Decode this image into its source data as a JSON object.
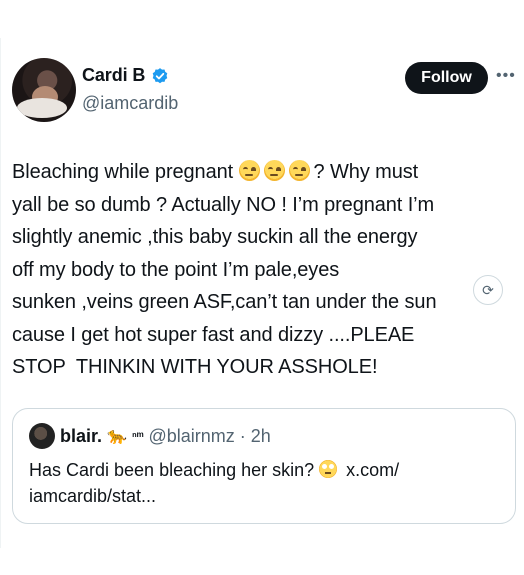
{
  "author": {
    "display_name": "Cardi B",
    "handle": "@iamcardib"
  },
  "actions": {
    "follow_label": "Follow",
    "more_icon": "more-horizontal-icon"
  },
  "tweet": {
    "line_1a": "Bleaching while pregnant ",
    "line_1b": "? Why must",
    "lines_rest": "yall be so dumb ? Actually NO ! I’m pregnant I’m\nslightly anemic ,this baby suckin all the energy\noff my body to the point I’m pale,eyes\nsunken ,veins green ASF,can’t tan under the sun\ncause I get hot super fast and dizzy ....PLEAE\nSTOP  THINKIN WITH YOUR ASSHOLE!",
    "emoji_icon": "unamused-face-icon"
  },
  "quote": {
    "display_name": "blair.",
    "badge_text": "ⁿᵐ",
    "handle": "@blairnmz",
    "time": "· 2h",
    "text_a": "Has Cardi been bleaching her skin? ",
    "text_b": " x.com/\niamcardib/stat..."
  },
  "colors": {
    "text": "#0f1419",
    "secondary": "#536471",
    "verified": "#1d9bf0",
    "border": "#cfd9de"
  }
}
